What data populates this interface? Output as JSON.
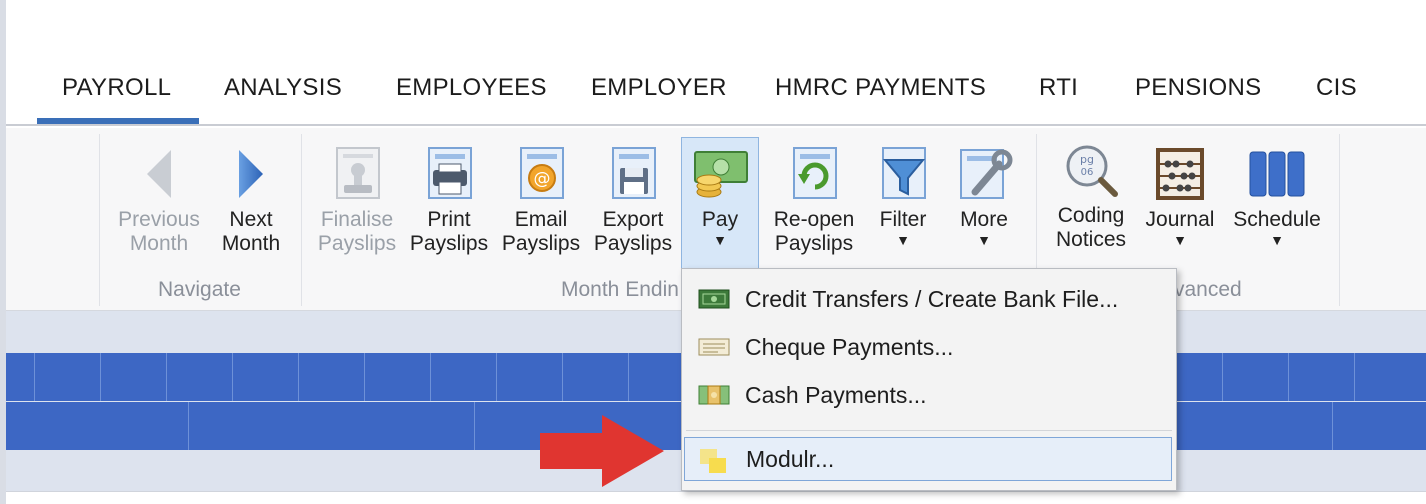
{
  "tabs": [
    "PAYROLL",
    "ANALYSIS",
    "EMPLOYEES",
    "EMPLOYER",
    "HMRC PAYMENTS",
    "RTI",
    "PENSIONS",
    "CIS"
  ],
  "active_tab": "PAYROLL",
  "ribbon": {
    "groups": {
      "navigate": "Navigate",
      "month_end": "Month Endin",
      "advanced": "vanced"
    },
    "buttons": {
      "previous_line1": "Previous",
      "previous_line2": "Month",
      "next_line1": "Next",
      "next_line2": "Month",
      "finalise_line1": "Finalise",
      "finalise_line2": "Payslips",
      "print_line1": "Print",
      "print_line2": "Payslips",
      "email_line1": "Email",
      "email_line2": "Payslips",
      "export_line1": "Export",
      "export_line2": "Payslips",
      "pay": "Pay",
      "reopen_line1": "Re-open",
      "reopen_line2": "Payslips",
      "filter": "Filter",
      "more": "More",
      "coding_line1": "Coding",
      "coding_line2": "Notices",
      "journal": "Journal",
      "schedule": "Schedule"
    },
    "arrow_glyph": "▼"
  },
  "pay_menu": {
    "items": [
      {
        "label": "Credit Transfers / Create Bank File...",
        "icon": "bank-note-icon"
      },
      {
        "label": "Cheque Payments...",
        "icon": "cheque-icon"
      },
      {
        "label": "Cash Payments...",
        "icon": "cash-icon"
      },
      {
        "label": "Modulr...",
        "icon": "modulr-icon"
      }
    ],
    "highlighted": "Modulr..."
  },
  "colors": {
    "accent": "#3a6fb8",
    "grid_blue": "#3d67c4",
    "annotation_arrow": "#e03530"
  }
}
